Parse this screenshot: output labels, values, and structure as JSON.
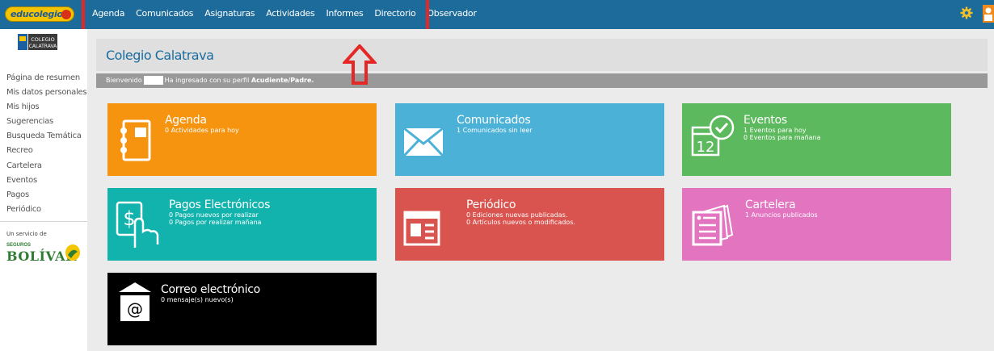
{
  "topbar": {
    "logo_text": "educolegios",
    "nav": [
      "Agenda",
      "Comunicados",
      "Asignaturas",
      "Actividades",
      "Informes",
      "Directorio",
      "Observador"
    ]
  },
  "sidebar": {
    "school_logo_text": "COLEGIO CALATRAVA",
    "items": [
      "Página de resumen",
      "Mis datos personales",
      "Mis hijos",
      "Sugerencias",
      "Busqueda Temática",
      "Recreo",
      "Cartelera",
      "Eventos",
      "Pagos",
      "Periódico"
    ],
    "service_label": "Un servicio de",
    "sponsor_top": "SEGUROS",
    "sponsor_name": "BOLÍVAR"
  },
  "main": {
    "school_name": "Colegio Calatrava",
    "welcome_prefix": "Bienvenido",
    "welcome_middle": "Ha ingresado con su perfil",
    "welcome_profile": "Acudiente/Padre."
  },
  "tiles": [
    {
      "title": "Agenda",
      "lines": [
        "0 Actividades para hoy"
      ],
      "color": "#f6930f"
    },
    {
      "title": "Comunicados",
      "lines": [
        "1 Comunicados sin leer"
      ],
      "color": "#4bb1d6"
    },
    {
      "title": "Eventos",
      "lines": [
        "1 Eventos para hoy",
        "0 Eventos para mañana"
      ],
      "color": "#5db95d"
    },
    {
      "title": "Pagos Electrónicos",
      "lines": [
        "0 Pagos nuevos por realizar",
        "0 Pagos por realizar mañana"
      ],
      "color": "#13b3ad"
    },
    {
      "title": "Periódico",
      "lines": [
        "0 Ediciones nuevas publicadas.",
        "0 Artículos nuevos o modificados."
      ],
      "color": "#d9534f"
    },
    {
      "title": "Cartelera",
      "lines": [
        "1 Anuncios publicados"
      ],
      "color": "#e374bf"
    },
    {
      "title": "Correo electrónico",
      "lines": [
        "0 mensaje(s) nuevo(s)"
      ],
      "color": "#000000"
    }
  ],
  "annotation": {
    "highlight_color": "#e42826"
  }
}
